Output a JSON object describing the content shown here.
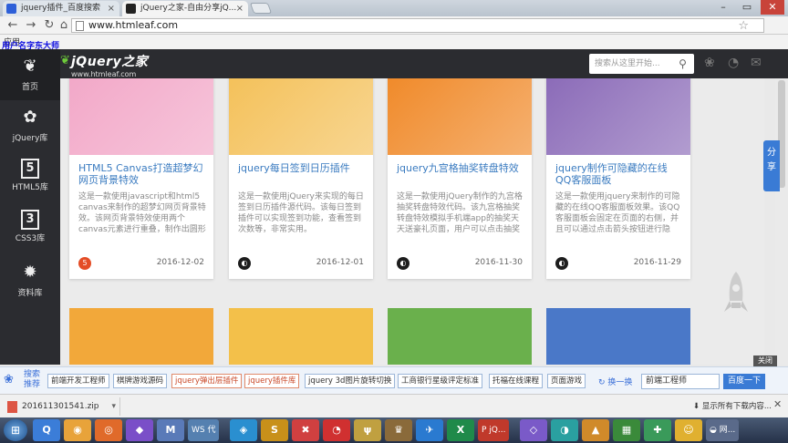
{
  "browser": {
    "tabs": [
      {
        "label": "jquery插件_百度搜索",
        "close": "×"
      },
      {
        "label": "jQuery之家-自由分享jQ...",
        "close": "×"
      }
    ],
    "window_controls": {
      "minimize": "–",
      "maximize": "▭",
      "close": "✕"
    },
    "address": "www.htmleaf.com",
    "bookmark_label": "应用",
    "user_label": "用户名字东大师"
  },
  "sidebar": {
    "items": [
      {
        "label": "首页",
        "icon": "leaf-icon",
        "glyph": "❦"
      },
      {
        "label": "jQuery库",
        "icon": "leaf-icon",
        "glyph": "✿"
      },
      {
        "label": "HTML5库",
        "icon": "html5-icon",
        "glyph": "5"
      },
      {
        "label": "CSS3库",
        "icon": "css3-icon",
        "glyph": "3"
      },
      {
        "label": "资料库",
        "icon": "gear-icon",
        "glyph": "✹"
      }
    ]
  },
  "header": {
    "logo": "jQuery之家",
    "logo_sub": "www.htmleaf.com",
    "search_placeholder": "搜索从这里开始...",
    "search_icon": "search-icon",
    "icons": [
      "paw-icon",
      "weibo-icon",
      "mail-icon"
    ]
  },
  "cards": [
    {
      "title": "HTML5 Canvas打造超梦幻网页背景特效",
      "desc": "这是一款使用javascript和html5 canvas来制作的超梦幻网页背景特效。该网页背景特效使用两个canvas元素进行重叠，制作出圆形",
      "date": "2016-12-02",
      "icon": "html5-icon",
      "icon_glyph": "5",
      "icon_color": "#e44d26",
      "thumb_color": "#f2a8c8"
    },
    {
      "title": "jquery每日签到日历插件",
      "desc": "这是一款使用jQuery来实现的每日签到日历插件源代码。该每日签到插件可以实现签到功能，查看签到次数等，非常实用。",
      "date": "2016-12-01",
      "icon": "jquery-icon",
      "icon_glyph": "◐",
      "icon_color": "#1d1d1d",
      "thumb_color": "#f4c15a"
    },
    {
      "title": "jquery九宫格抽奖转盘特效",
      "desc": "这是一款使用jQuery制作的九宫格抽奖转盘特效代码。该九宫格抽奖转盘特效模拟手机端app的抽奖天天送豪礼页面，用户可以点击抽奖",
      "date": "2016-11-30",
      "icon": "jquery-icon",
      "icon_glyph": "◐",
      "icon_color": "#1d1d1d",
      "thumb_color": "#f08a2a"
    },
    {
      "title": "jquery制作可隐藏的在线QQ客服面板",
      "desc": "这是一款使用jquery来制作的可隐藏的在线QQ客服面板效果。该QQ客服面板会固定在页面的右侧，并且可以通过点击箭头按钮进行隐",
      "date": "2016-11-29",
      "icon": "jquery-icon",
      "icon_glyph": "◐",
      "icon_color": "#1d1d1d",
      "thumb_color": "#8b6bb8"
    }
  ],
  "cards_row2": [
    {
      "thumb_color": "#f2a83a"
    },
    {
      "thumb_color": "#f3c04a"
    },
    {
      "thumb_color": "#6ab04c"
    },
    {
      "thumb_color": "#4a78c8"
    }
  ],
  "share_label": "分享",
  "close_label": "关闭",
  "baidu_bar": {
    "label": "搜索推荐",
    "chips": [
      {
        "text": "前端开发工程师",
        "highlight": false
      },
      {
        "text": "棋牌游戏源码",
        "highlight": false
      },
      {
        "text": "jquery弹出层插件",
        "highlight": true
      },
      {
        "text": "jquery插件库",
        "highlight": true
      },
      {
        "text": "jquery 3d图片旋转切换",
        "highlight": false
      },
      {
        "text": "工商银行星级评定标准",
        "highlight": false
      },
      {
        "text": "托福在线课程",
        "highlight": false
      },
      {
        "text": "页面游戏",
        "highlight": false
      }
    ],
    "change_label": "换一换",
    "input_value": "前端工程师",
    "search_button": "百度一下"
  },
  "downloads": {
    "file": "201611301541.zip",
    "show_all": "显示所有下载内容...",
    "close": "✕"
  },
  "taskbar": {
    "items": [
      "Q",
      "◉",
      "◎",
      "◆",
      "M",
      "WS 代",
      "◈",
      "S",
      "✖",
      "◔",
      "ψ",
      "♛",
      "✈",
      "X",
      "P jQ...",
      "◇",
      "◑",
      "▲",
      "▦",
      "✚",
      "☺",
      "◒ 网..."
    ]
  }
}
